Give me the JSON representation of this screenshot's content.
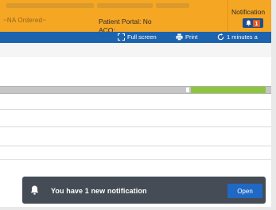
{
  "banner": {
    "left_text": "~NA Ordered~",
    "portal_line": "Patient Portal: No",
    "aco_line": "ACO:",
    "color": "#f5a623"
  },
  "notifications": {
    "title": "Notification",
    "count": "1",
    "icon": "bell-icon"
  },
  "toolbar": {
    "fullscreen_label": "Full screen",
    "print_label": "Print",
    "refresh_label": "1 minutes a",
    "color": "#1e63ad"
  },
  "toast": {
    "message": "You have 1 new notification",
    "open_label": "Open",
    "icon": "bell-icon"
  }
}
